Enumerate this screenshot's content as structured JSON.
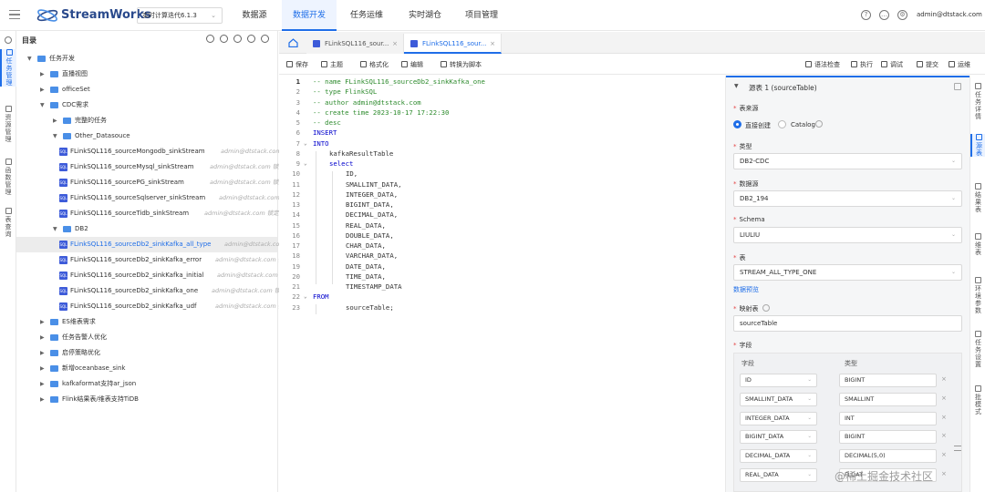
{
  "colors": {
    "accent": "#1f6ee8",
    "brand": "#2a4a8c",
    "comment": "#2e8b2e",
    "keyword": "#0000cc",
    "required": "#e54545"
  },
  "app": {
    "brand": "StreamWorks",
    "version": "实时计算迭代6.1.3",
    "user": "admin@dtstack.com"
  },
  "nav": [
    "数据源",
    "数据开发",
    "任务运维",
    "实时湖仓",
    "项目管理"
  ],
  "top_icons": [
    "help-icon",
    "chat-icon",
    "settings-icon"
  ],
  "leftbar": [
    {
      "label": "任务管理",
      "chars": [
        "任",
        "务",
        "管",
        "理"
      ],
      "icon": "task-icon"
    },
    {
      "label": "资源管理",
      "chars": [
        "资",
        "源",
        "管",
        "理"
      ],
      "icon": "resource-icon"
    },
    {
      "label": "函数管理",
      "chars": [
        "函",
        "数",
        "管",
        "理"
      ],
      "icon": "function-icon"
    },
    {
      "label": "表查询",
      "chars": [
        "表",
        "查",
        "询"
      ],
      "icon": "table-query-icon"
    }
  ],
  "tree": {
    "title": "目录",
    "tools": [
      "location-icon",
      "refresh-icon",
      "more-icon",
      "send-icon",
      "add-icon"
    ],
    "items": [
      {
        "label": "任务开发",
        "type": "folder",
        "level": 0,
        "open": true,
        "meta": ""
      },
      {
        "label": "直播视图",
        "type": "folder",
        "level": 1,
        "open": false,
        "meta": ""
      },
      {
        "label": "officeSet",
        "type": "folder",
        "level": 1,
        "open": false,
        "meta": ""
      },
      {
        "label": "CDC需求",
        "type": "folder",
        "level": 1,
        "open": true,
        "meta": ""
      },
      {
        "label": "完整的任务",
        "type": "folder",
        "level": 2,
        "open": false,
        "meta": ""
      },
      {
        "label": "Other_Datasouce",
        "type": "folder",
        "level": 2,
        "open": true,
        "meta": ""
      },
      {
        "label": "FLinkSQL116_sourceMongodb_sinkStream",
        "type": "sql",
        "level": 3,
        "meta": "admin@dtstack.com..."
      },
      {
        "label": "FLinkSQL116_sourceMysql_sinkStream",
        "type": "sql",
        "level": 3,
        "meta": "admin@dtstack.com 锁定..."
      },
      {
        "label": "FLinkSQL116_sourcePG_sinkStream",
        "type": "sql",
        "level": 3,
        "meta": "admin@dtstack.com 锁定子..."
      },
      {
        "label": "FLinkSQL116_sourceSqlserver_sinkStream",
        "type": "sql",
        "level": 3,
        "meta": "admin@dtstack.com..."
      },
      {
        "label": "FLinkSQL116_sourceTidb_sinkStream",
        "type": "sql",
        "level": 3,
        "meta": "admin@dtstack.com 锁定子..."
      },
      {
        "label": "DB2",
        "type": "folder",
        "level": 2,
        "open": true,
        "meta": ""
      },
      {
        "label": "FLinkSQL116_sourceDb2_sinkKafka_all_type",
        "type": "sql",
        "level": 3,
        "meta": "admin@dtstack.com...",
        "selected": true
      },
      {
        "label": "FLinkSQL116_sourceDb2_sinkKafka_error",
        "type": "sql",
        "level": 3,
        "meta": "admin@dtstack.com 锁..."
      },
      {
        "label": "FLinkSQL116_sourceDb2_sinkKafka_initial",
        "type": "sql",
        "level": 3,
        "meta": "admin@dtstack.com 锁..."
      },
      {
        "label": "FLinkSQL116_sourceDb2_sinkKafka_one",
        "type": "sql",
        "level": 3,
        "meta": "admin@dtstack.com 锁..."
      },
      {
        "label": "FLinkSQL116_sourceDb2_sinkKafka_udf",
        "type": "sql",
        "level": 3,
        "meta": "admin@dtstack.com 锁..."
      },
      {
        "label": "ES维表需求",
        "type": "folder",
        "level": 1,
        "open": false,
        "meta": ""
      },
      {
        "label": "任务告警人优化",
        "type": "folder",
        "level": 1,
        "open": false,
        "meta": ""
      },
      {
        "label": "启停策略优化",
        "type": "folder",
        "level": 1,
        "open": false,
        "meta": ""
      },
      {
        "label": "新增oceanbase_sink",
        "type": "folder",
        "level": 1,
        "open": false,
        "meta": ""
      },
      {
        "label": "kafkaformat支持ar_json",
        "type": "folder",
        "level": 1,
        "open": false,
        "meta": ""
      },
      {
        "label": "Flink结果表/维表支持TiDB",
        "type": "folder",
        "level": 1,
        "open": false,
        "meta": ""
      }
    ]
  },
  "file_tabs": [
    {
      "label": "FLinkSQL116_sour...",
      "active": false
    },
    {
      "label": "FLinkSQL116_sour...",
      "active": true
    }
  ],
  "toolbar": {
    "left": [
      {
        "label": "保存",
        "icon": "save-icon"
      },
      {
        "label": "主题",
        "icon": "theme-icon"
      },
      {
        "label": "格式化",
        "icon": "format-icon"
      },
      {
        "label": "编辑",
        "icon": "edit-icon"
      },
      {
        "label": "转换为脚本",
        "icon": "convert-icon"
      }
    ],
    "right": [
      {
        "label": "语法检查",
        "icon": "syntax-check-icon"
      },
      {
        "label": "执行",
        "icon": "run-icon"
      },
      {
        "label": "调试",
        "icon": "debug-icon"
      },
      {
        "label": "提交",
        "icon": "submit-icon"
      },
      {
        "label": "运维",
        "icon": "ops-icon"
      }
    ]
  },
  "editor": {
    "current_line": 1,
    "lines": [
      {
        "n": 1,
        "text": "-- name FLinkSQL116_sourceDb2_sinkKafka_one",
        "kind": "comment",
        "indent": 0
      },
      {
        "n": 2,
        "text": "-- type FlinkSQL",
        "kind": "comment",
        "indent": 0
      },
      {
        "n": 3,
        "text": "-- author admin@dtstack.com",
        "kind": "comment",
        "indent": 0
      },
      {
        "n": 4,
        "text": "-- create time 2023-10-17 17:22:30",
        "kind": "comment",
        "indent": 0
      },
      {
        "n": 5,
        "text": "-- desc",
        "kind": "comment",
        "indent": 0
      },
      {
        "n": 6,
        "text": "INSERT",
        "kind": "keyword",
        "indent": 0
      },
      {
        "n": 7,
        "text": "INTO",
        "kind": "keyword",
        "indent": 0,
        "fold": true
      },
      {
        "n": 8,
        "text": "kafkaResultTable",
        "kind": "plain",
        "indent": 1
      },
      {
        "n": 9,
        "text": "select",
        "kind": "keyword",
        "indent": 1,
        "fold": true
      },
      {
        "n": 10,
        "text": "ID,",
        "kind": "plain",
        "indent": 2
      },
      {
        "n": 11,
        "text": "SMALLINT_DATA,",
        "kind": "plain",
        "indent": 2
      },
      {
        "n": 12,
        "text": "INTEGER_DATA,",
        "kind": "plain",
        "indent": 2
      },
      {
        "n": 13,
        "text": "BIGINT_DATA,",
        "kind": "plain",
        "indent": 2
      },
      {
        "n": 14,
        "text": "DECIMAL_DATA,",
        "kind": "plain",
        "indent": 2
      },
      {
        "n": 15,
        "text": "REAL_DATA,",
        "kind": "plain",
        "indent": 2
      },
      {
        "n": 16,
        "text": "DOUBLE_DATA,",
        "kind": "plain",
        "indent": 2
      },
      {
        "n": 17,
        "text": "CHAR_DATA,",
        "kind": "plain",
        "indent": 2
      },
      {
        "n": 18,
        "text": "VARCHAR_DATA,",
        "kind": "plain",
        "indent": 2
      },
      {
        "n": 19,
        "text": "DATE_DATA,",
        "kind": "plain",
        "indent": 2
      },
      {
        "n": 20,
        "text": "TIME_DATA,",
        "kind": "plain",
        "indent": 2
      },
      {
        "n": 21,
        "text": "TIMESTAMP_DATA",
        "kind": "plain",
        "indent": 2
      },
      {
        "n": 22,
        "text": "FROM",
        "kind": "keyword",
        "indent": 0,
        "fold": true
      },
      {
        "n": 23,
        "text": "sourceTable;",
        "kind": "plain",
        "indent": 2
      }
    ]
  },
  "source_panel": {
    "title": "源表 1 (sourceTable)",
    "labels": {
      "source_mode": "表来源",
      "type": "类型",
      "datasource": "数据源",
      "schema": "Schema",
      "table": "表",
      "mapping": "映射表",
      "fields": "字段"
    },
    "source_mode_options": [
      "直接创建",
      "Catalog"
    ],
    "source_mode_selected": "直接创建",
    "type": "DB2-CDC",
    "datasource": "DB2_194",
    "schema": "LIULIU",
    "table": "STREAM_ALL_TYPE_ONE",
    "preview_link": "数据预览",
    "mapping": "sourceTable",
    "field_headers": [
      "字段",
      "类型"
    ],
    "fields": [
      {
        "name": "ID",
        "type": "BIGINT"
      },
      {
        "name": "SMALLINT_DATA",
        "type": "SMALLINT"
      },
      {
        "name": "INTEGER_DATA",
        "type": "INT"
      },
      {
        "name": "BIGINT_DATA",
        "type": "BIGINT"
      },
      {
        "name": "DECIMAL_DATA",
        "type": "DECIMAL(5,0)"
      },
      {
        "name": "REAL_DATA",
        "type": "FLOAT"
      }
    ]
  },
  "right_tabs": [
    {
      "label": "任务详情",
      "chars": [
        "任",
        "务",
        "详",
        "情"
      ],
      "icon": "detail-icon"
    },
    {
      "label": "源表",
      "chars": [
        "源",
        "表"
      ],
      "icon": "source-table-icon",
      "active": true
    },
    {
      "label": "结果表",
      "chars": [
        "结",
        "果",
        "表"
      ],
      "icon": "result-table-icon"
    },
    {
      "label": "维表",
      "chars": [
        "维",
        "表"
      ],
      "icon": "dim-table-icon"
    },
    {
      "label": "环境参数",
      "chars": [
        "环",
        "境",
        "参",
        "数"
      ],
      "icon": "env-icon"
    },
    {
      "label": "任务设置",
      "chars": [
        "任",
        "务",
        "设",
        "置"
      ],
      "icon": "task-settings-icon"
    },
    {
      "label": "批模式",
      "chars": [
        "批",
        "模",
        "式"
      ],
      "icon": "batch-icon"
    }
  ],
  "watermark": "@稀土掘金技术社区"
}
